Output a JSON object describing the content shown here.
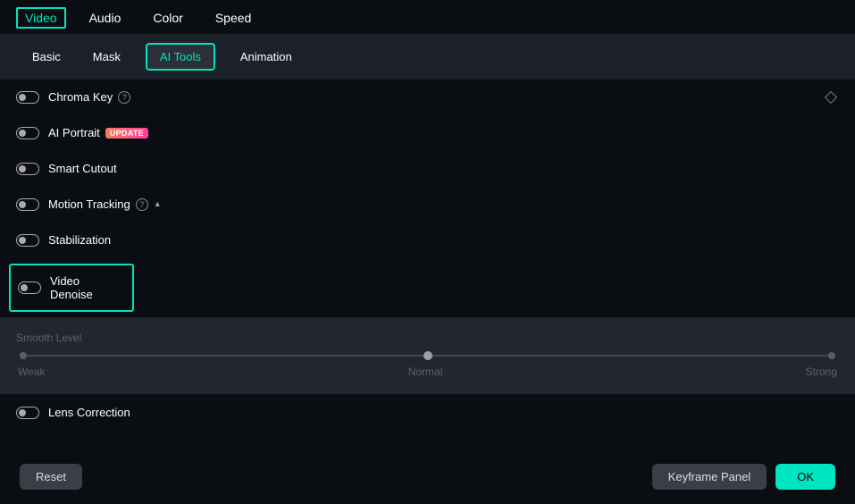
{
  "mainTabs": {
    "video": "Video",
    "audio": "Audio",
    "color": "Color",
    "speed": "Speed"
  },
  "subTabs": {
    "basic": "Basic",
    "mask": "Mask",
    "aiTools": "AI Tools",
    "animation": "Animation"
  },
  "tools": {
    "chromaKey": "Chroma Key",
    "aiPortrait": "AI Portrait",
    "updateBadge": "UPDATE",
    "smartCutout": "Smart Cutout",
    "motionTracking": "Motion Tracking",
    "stabilization": "Stabilization",
    "videoDenoise": "Video Denoise",
    "lensCorrection": "Lens Correction"
  },
  "denoise": {
    "smoothLabel": "Smooth Level",
    "weak": "Weak",
    "normal": "Normal",
    "strong": "Strong"
  },
  "footer": {
    "reset": "Reset",
    "keyframe": "Keyframe Panel",
    "ok": "OK"
  }
}
